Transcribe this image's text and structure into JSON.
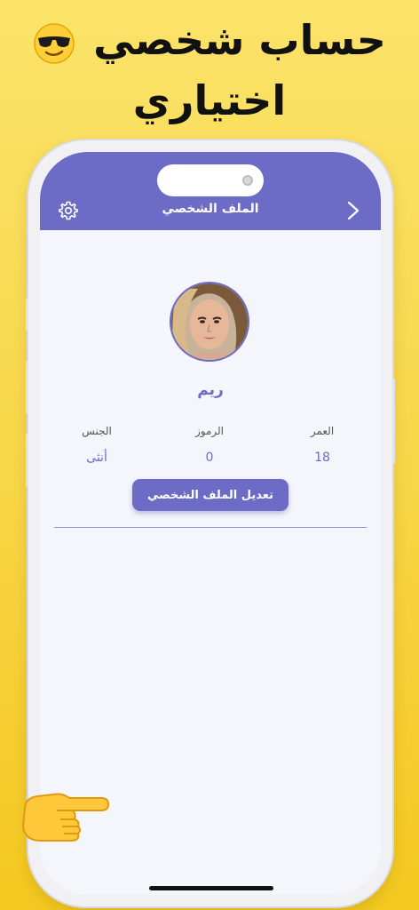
{
  "promo": {
    "headline_line1": "حساب شخصي",
    "headline_line2": "اختياري",
    "headline_emoji_icon": "sunglasses-face-emoji",
    "pointer_emoji_icon": "pointing-hand-emoji"
  },
  "navbar": {
    "title": "الملف الشخصي",
    "settings_icon": "gear-icon",
    "back_icon": "chevron-right-icon"
  },
  "profile": {
    "name": "ريم",
    "stats": [
      {
        "label": "العمر",
        "value": "18"
      },
      {
        "label": "الرموز",
        "value": "0"
      },
      {
        "label": "الجنس",
        "value": "أنثى"
      }
    ],
    "edit_button_label": "تعديل الملف الشخصي"
  },
  "colors": {
    "accent": "#6c6bc5",
    "screen_background": "#f5f6fc",
    "page_background": "#f8d545"
  }
}
